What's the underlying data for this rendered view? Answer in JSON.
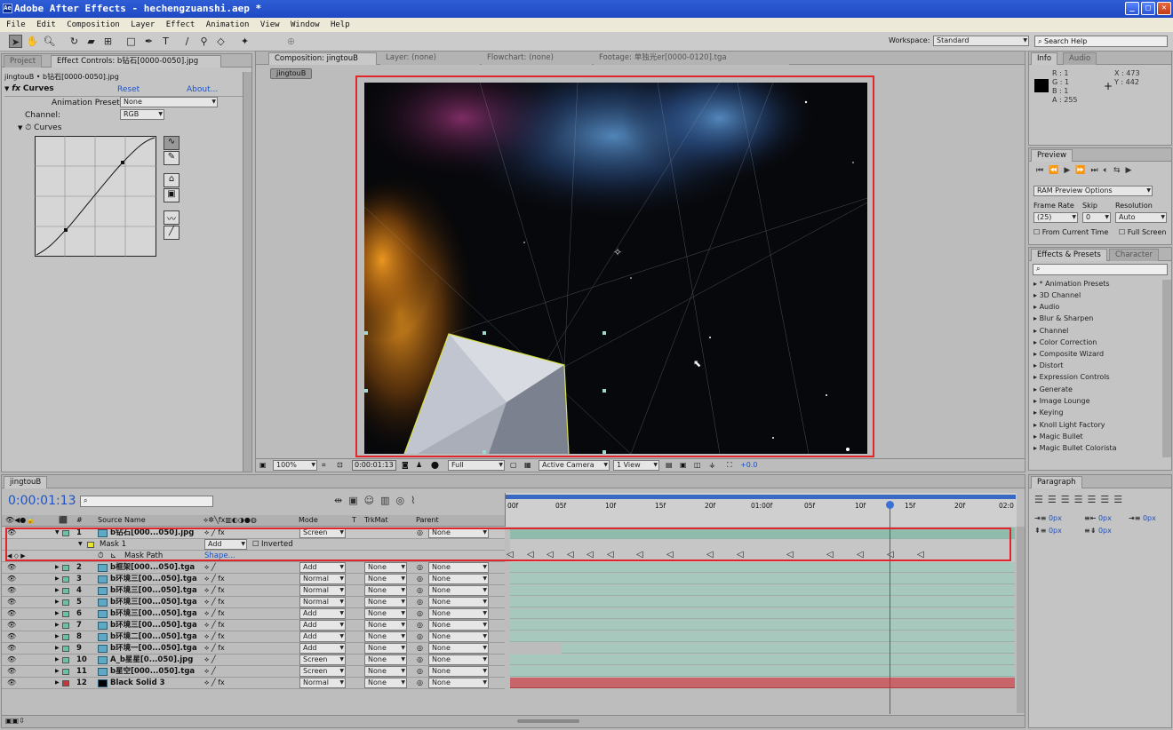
{
  "window": {
    "title": "Adobe After Effects - hechengzuanshi.aep *",
    "app_icon": "Ae"
  },
  "menu": [
    "File",
    "Edit",
    "Composition",
    "Layer",
    "Effect",
    "Animation",
    "View",
    "Window",
    "Help"
  ],
  "workspace": {
    "label": "Workspace:",
    "value": "Standard"
  },
  "search_help": "Search Help",
  "project_panel": {
    "tabs": [
      "Project",
      "Effect Controls: b钻石[0000-0050].jpg"
    ],
    "path": "jingtouB • b钻石[0000-0050].jpg",
    "effect": {
      "name": "Curves",
      "reset": "Reset",
      "about": "About...",
      "animation_presets_label": "Animation Presets:",
      "animation_presets_value": "None",
      "channel_label": "Channel:",
      "channel_value": "RGB",
      "curves_label": "Curves"
    }
  },
  "comp_panel": {
    "tabs": [
      "Composition: jingtouB",
      "Layer: (none)",
      "Flowchart: (none)",
      "Footage: 单独光er[0000-0120].tga"
    ],
    "crumb": "jingtouB",
    "footer": {
      "zoom": "100%",
      "time": "0:00:01:13",
      "resolution": "Full",
      "camera": "Active Camera",
      "views": "1 View",
      "exposure": "+0.0"
    }
  },
  "info_panel": {
    "tabs": [
      "Info",
      "Audio"
    ],
    "r": "R : 1",
    "g": "G : 1",
    "b": "B : 1",
    "a": "A : 255",
    "x": "X : 473",
    "y": "Y : 442"
  },
  "preview_panel": {
    "tabs": [
      "Preview"
    ],
    "ram": "RAM Preview Options",
    "frame_rate_label": "Frame Rate",
    "skip_label": "Skip",
    "resolution_label": "Resolution",
    "frame_rate": "(25)",
    "skip": "0",
    "resolution": "Auto",
    "from_current": "From Current Time",
    "full_screen": "Full Screen"
  },
  "effects_panel": {
    "tabs": [
      "Effects & Presets",
      "Character"
    ],
    "items": [
      "* Animation Presets",
      "3D Channel",
      "Audio",
      "Blur & Sharpen",
      "Channel",
      "Color Correction",
      "Composite Wizard",
      "Distort",
      "Expression Controls",
      "Generate",
      "Image Lounge",
      "Keying",
      "Knoll Light Factory",
      "Magic Bullet",
      "Magic Bullet Colorista"
    ]
  },
  "paragraph_panel": {
    "tabs": [
      "Paragraph"
    ],
    "indent1": "0px",
    "indent2": "0px",
    "indent3": "0px",
    "space1": "0px",
    "space2": "0px"
  },
  "timeline": {
    "tab": "jingtouB",
    "timecode": "0:00:01:13",
    "headers": {
      "source": "Source Name",
      "mode": "Mode",
      "t": "T",
      "trkmat": "TrkMat",
      "parent": "Parent"
    },
    "ruler": [
      "00f",
      "05f",
      "10f",
      "15f",
      "20f",
      "01:00f",
      "05f",
      "10f",
      "15f",
      "20f",
      "02:0"
    ],
    "mask": {
      "name": "Mask 1",
      "mode": "Add",
      "inverted": "Inverted",
      "path": "Mask Path",
      "shape": "Shape..."
    },
    "layers": [
      {
        "num": "1",
        "name": "b钻石[000...050].jpg",
        "mode": "Screen",
        "trk": "",
        "parent": "None",
        "color": "#6ac1a8"
      },
      {
        "num": "2",
        "name": "b框架[000...050].tga",
        "mode": "Add",
        "trk": "None",
        "parent": "None",
        "color": "#6ac1a8"
      },
      {
        "num": "3",
        "name": "b环境三[00...050].tga",
        "mode": "Normal",
        "trk": "None",
        "parent": "None",
        "color": "#6ac1a8"
      },
      {
        "num": "4",
        "name": "b环境三[00...050].tga",
        "mode": "Normal",
        "trk": "None",
        "parent": "None",
        "color": "#6ac1a8"
      },
      {
        "num": "5",
        "name": "b环境三[00...050].tga",
        "mode": "Normal",
        "trk": "None",
        "parent": "None",
        "color": "#6ac1a8"
      },
      {
        "num": "6",
        "name": "b环境三[00...050].tga",
        "mode": "Add",
        "trk": "None",
        "parent": "None",
        "color": "#6ac1a8"
      },
      {
        "num": "7",
        "name": "b环境三[00...050].tga",
        "mode": "Add",
        "trk": "None",
        "parent": "None",
        "color": "#6ac1a8"
      },
      {
        "num": "8",
        "name": "b环境二[00...050].tga",
        "mode": "Add",
        "trk": "None",
        "parent": "None",
        "color": "#6ac1a8"
      },
      {
        "num": "9",
        "name": "b环境一[00...050].tga",
        "mode": "Add",
        "trk": "None",
        "parent": "None",
        "color": "#6ac1a8"
      },
      {
        "num": "10",
        "name": "A_b星星[0...050].jpg",
        "mode": "Screen",
        "trk": "None",
        "parent": "None",
        "color": "#6ac1a8"
      },
      {
        "num": "11",
        "name": "b星空[000...050].tga",
        "mode": "Screen",
        "trk": "None",
        "parent": "None",
        "color": "#6ac1a8"
      },
      {
        "num": "12",
        "name": "Black Solid 3",
        "mode": "Normal",
        "trk": "None",
        "parent": "None",
        "color": "#c0393b"
      }
    ]
  }
}
